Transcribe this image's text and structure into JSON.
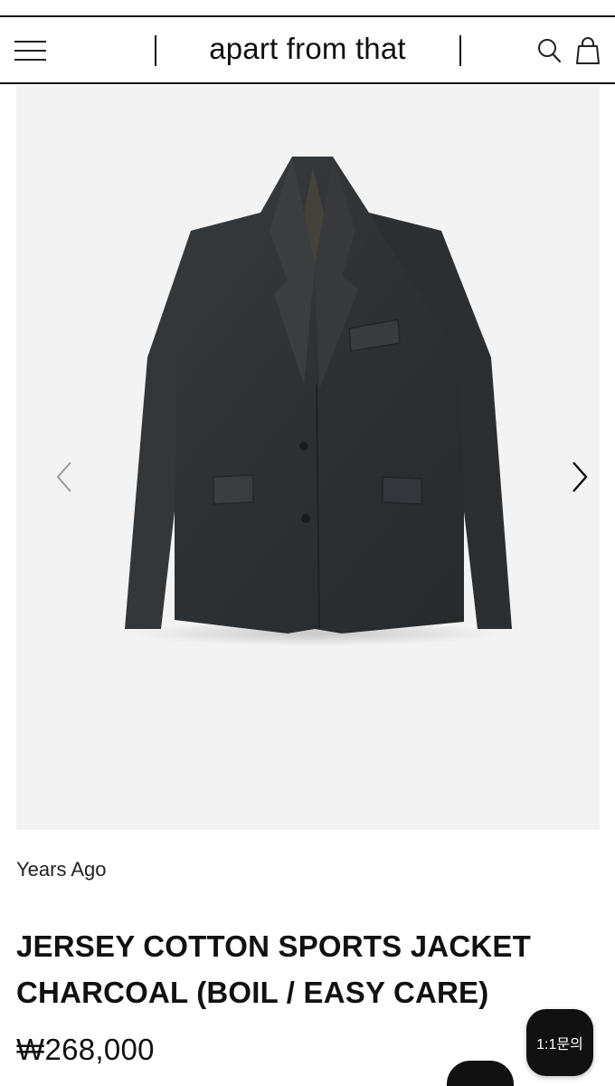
{
  "header": {
    "logo": "apart from that",
    "menu_icon": "hamburger-menu-icon",
    "search_icon": "search-icon",
    "bag_icon": "shopping-bag-icon"
  },
  "gallery": {
    "image_subject": "charcoal jersey cotton sports jacket",
    "prev_icon": "chevron-left-icon",
    "next_icon": "chevron-right-icon"
  },
  "product": {
    "brand": "Years Ago",
    "title_line1": "JERSEY COTTON SPORTS JACKET",
    "title_line2": "CHARCOAL (BOIL / EASY CARE)",
    "price": "₩268,000"
  },
  "floating": {
    "inquiry_label": "1:1문의"
  },
  "colors": {
    "background": "#ffffff",
    "text": "#111111",
    "gallery_bg": "#f3f3f3",
    "jacket": "#2f3234"
  }
}
